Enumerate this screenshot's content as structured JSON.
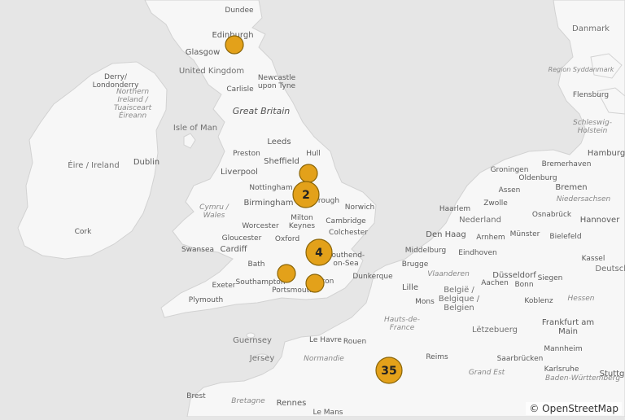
{
  "attribution": "© OpenStreetMap",
  "colors": {
    "sea": "#e6e6e6",
    "land": "#f7f7f7",
    "marker_fill": "#e3a11a",
    "marker_stroke": "#8a6508",
    "label": "#5a5a5a"
  },
  "labels": {
    "dundee": "Dundee",
    "edinburgh": "Edinburgh",
    "glasgow": "Glasgow",
    "united_kingdom": "United Kingdom",
    "derry": "Derry/\nLondonderry",
    "northern_ireland": "Northern\nIreland /\nTuaisceart\nÉireann",
    "carlisle": "Carlisle",
    "newcastle": "Newcastle\nupon Tyne",
    "great_britain": "Great Britain",
    "isle_of_man": "Isle of Man",
    "dublin": "Dublin",
    "eire": "Éire / Ireland",
    "cork": "Cork",
    "leeds": "Leeds",
    "preston": "Preston",
    "hull": "Hull",
    "sheffield": "Sheffield",
    "liverpool": "Liverpool",
    "nottingham": "Nottingham",
    "birmingham": "Birmingham",
    "peterborough": "rough",
    "norwich": "Norwich",
    "cymru": "Cymru /\nWales",
    "milton_keynes": "Milton\nKeynes",
    "cambridge": "Cambridge",
    "worcester": "Worcester",
    "colchester": "Colchester",
    "gloucester": "Gloucester",
    "oxford": "Oxford",
    "swansea": "Swansea",
    "cardiff": "Cardiff",
    "southend": "Southend-\non-Sea",
    "bath": "Bath",
    "southampton": "Southampton",
    "brighton": "ton",
    "portsmouth": "Portsmouth",
    "exeter": "Exeter",
    "plymouth": "Plymouth",
    "guernsey": "Guernsey",
    "jersey": "Jersey",
    "le_havre": "Le Havre",
    "rouen": "Rouen",
    "normandie": "Normandie",
    "brest": "Brest",
    "bretagne": "Bretagne",
    "rennes": "Rennes",
    "le_mans": "Le Mans",
    "danmark": "Danmark",
    "region_syddanmark": "Region Syddanmark",
    "flensburg": "Flensburg",
    "schleswig": "Schleswig-\nHolstein",
    "hamburg": "Hamburg",
    "groningen": "Groningen",
    "oldenburg": "Oldenburg",
    "bremerhaven": "Bremerhaven",
    "assen": "Assen",
    "bremen": "Bremen",
    "niedersachsen": "Niedersachsen",
    "haarlem": "Haarlem",
    "zwolle": "Zwolle",
    "osnabruck": "Osnabrück",
    "hannover": "Hannover",
    "nederland": "Nederland",
    "den_haag": "Den Haag",
    "arnhem": "Arnhem",
    "munster": "Münster",
    "bielefeld": "Bielefeld",
    "middelburg": "Middelburg",
    "eindhoven": "Eindhoven",
    "kassel": "Kassel",
    "brugge": "Brugge",
    "vlaanderen": "Vlaanderen",
    "dusseldorf": "Düsseldorf",
    "deutsch": "Deutsch",
    "dunkerque": "Dunkerque",
    "lille": "Lille",
    "aachen": "Aachen",
    "siegen": "Siegen",
    "belgie": "België /\nBelgique /\nBelgien",
    "bonn": "Bonn",
    "mons": "Mons",
    "koblenz": "Koblenz",
    "hessen": "Hessen",
    "hauts_de_france": "Hauts-de-\nFrance",
    "letzebuerg": "Lëtzebuerg",
    "frankfurt": "Frankfurt am\nMain",
    "mannheim": "Mannheim",
    "reims": "Reims",
    "saarbrucken": "Saarbrücken",
    "grand_est": "Grand Est",
    "karlsruhe": "Karlsruhe",
    "baden": "Baden-Württemberg",
    "stuttgart": "Stuttg"
  },
  "clusters": [
    {
      "id": "edinburgh",
      "count": ""
    },
    {
      "id": "hull",
      "count": ""
    },
    {
      "id": "midlands",
      "count": "2"
    },
    {
      "id": "london",
      "count": "4"
    },
    {
      "id": "southampton",
      "count": ""
    },
    {
      "id": "brighton",
      "count": ""
    },
    {
      "id": "paris",
      "count": "35"
    }
  ]
}
